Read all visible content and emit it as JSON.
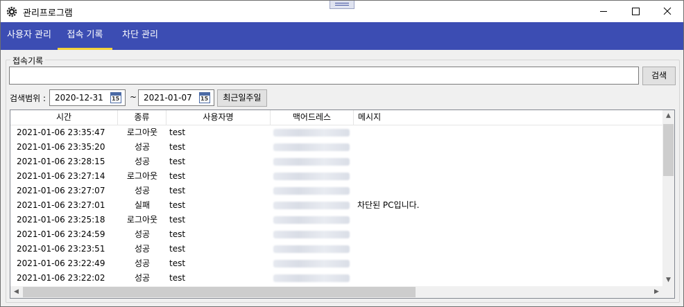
{
  "window": {
    "title": "관리프로그램"
  },
  "tabs": [
    {
      "label": "사용자 관리"
    },
    {
      "label": "접속 기록"
    },
    {
      "label": "차단 관리"
    }
  ],
  "group": {
    "label": "접속기록"
  },
  "search": {
    "value": "",
    "button_label": "검색"
  },
  "range": {
    "label": "검색범위 :",
    "start": "2020-12-31",
    "separator": "~",
    "end": "2021-01-07",
    "calendar_day": "15",
    "recent_week_label": "최근일주일"
  },
  "table": {
    "columns": [
      "시간",
      "종류",
      "사용자명",
      "맥어드레스",
      "메시지"
    ],
    "rows": [
      {
        "time": "2021-01-06 23:35:47",
        "type": "로그아웃",
        "user": "test",
        "msg": ""
      },
      {
        "time": "2021-01-06 23:35:20",
        "type": "성공",
        "user": "test",
        "msg": ""
      },
      {
        "time": "2021-01-06 23:28:15",
        "type": "성공",
        "user": "test",
        "msg": ""
      },
      {
        "time": "2021-01-06 23:27:14",
        "type": "로그아웃",
        "user": "test",
        "msg": ""
      },
      {
        "time": "2021-01-06 23:27:07",
        "type": "성공",
        "user": "test",
        "msg": ""
      },
      {
        "time": "2021-01-06 23:27:01",
        "type": "실패",
        "user": "test",
        "msg": "차단된 PC입니다."
      },
      {
        "time": "2021-01-06 23:25:18",
        "type": "로그아웃",
        "user": "test",
        "msg": ""
      },
      {
        "time": "2021-01-06 23:24:59",
        "type": "성공",
        "user": "test",
        "msg": ""
      },
      {
        "time": "2021-01-06 23:23:51",
        "type": "성공",
        "user": "test",
        "msg": ""
      },
      {
        "time": "2021-01-06 23:22:49",
        "type": "성공",
        "user": "test",
        "msg": ""
      },
      {
        "time": "2021-01-06 23:22:02",
        "type": "성공",
        "user": "test",
        "msg": ""
      }
    ]
  },
  "colors": {
    "tab_bar": "#3c4db3",
    "tab_indicator": "#f5d33a"
  }
}
